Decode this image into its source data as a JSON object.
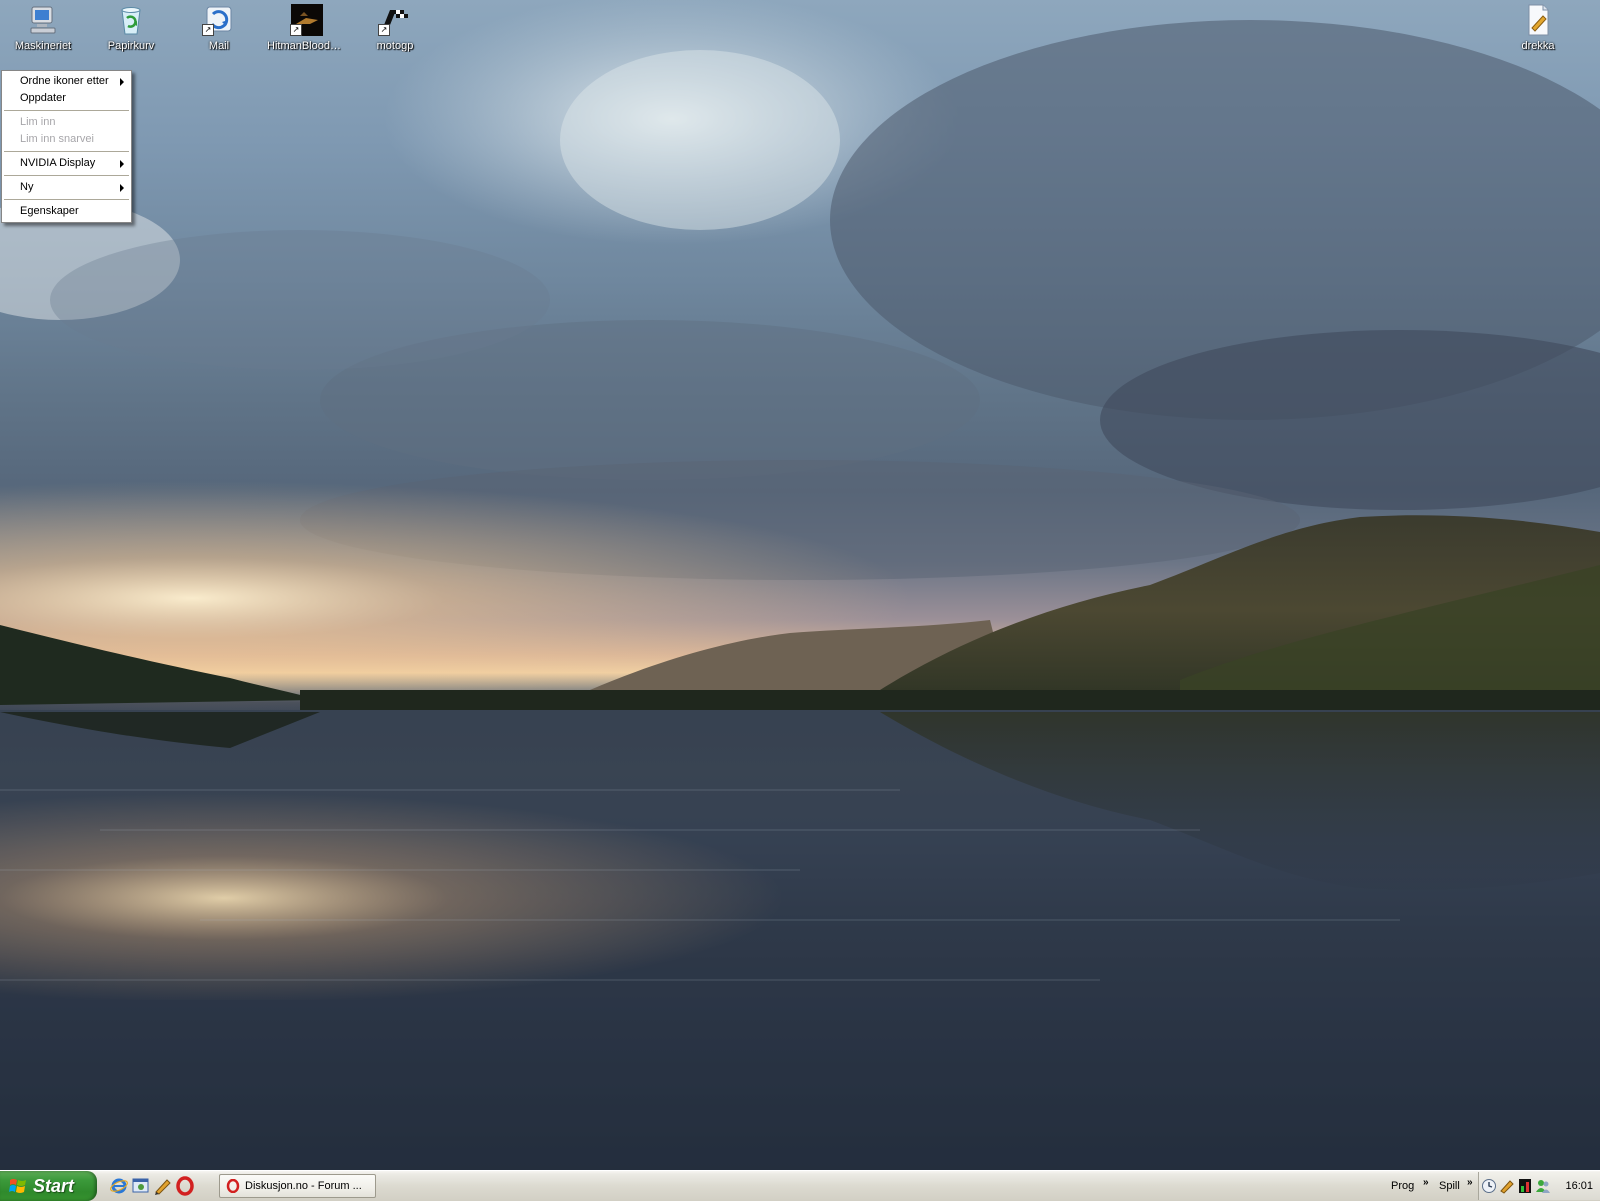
{
  "desktop": {
    "icons": [
      {
        "label": "Maskineriet",
        "icon": "my-computer-icon"
      },
      {
        "label": "Papirkurv",
        "icon": "recycle-bin-icon"
      },
      {
        "label": "Mail",
        "icon": "mail-shortcut-icon"
      },
      {
        "label": "HitmanBloodM...",
        "icon": "hitman-game-icon"
      },
      {
        "label": "motogp",
        "icon": "motogp-game-icon"
      },
      {
        "label": "drekka",
        "icon": "text-document-icon"
      }
    ]
  },
  "context_menu": {
    "items": [
      {
        "label": "Ordne ikoner etter",
        "submenu": true,
        "enabled": true
      },
      {
        "label": "Oppdater",
        "submenu": false,
        "enabled": true
      },
      {
        "label": "Lim inn",
        "submenu": false,
        "enabled": false
      },
      {
        "label": "Lim inn snarvei",
        "submenu": false,
        "enabled": false
      },
      {
        "label": "NVIDIA Display",
        "submenu": true,
        "enabled": true
      },
      {
        "label": "Ny",
        "submenu": true,
        "enabled": true
      },
      {
        "label": "Egenskaper",
        "submenu": false,
        "enabled": true
      }
    ]
  },
  "taskbar": {
    "start_label": "Start",
    "quick_launch": [
      "internet-explorer-icon",
      "show-desktop-icon",
      "pencil-icon",
      "opera-icon"
    ],
    "task_button_label": "Diskusjon.no - Forum ...",
    "toolbars": [
      "Prog",
      "Spill"
    ],
    "clock": "16:01"
  },
  "colors": {
    "start_green": "#3c9a3b",
    "menu_disabled": "#a7a6aa",
    "taskbar_bg": "#dcdad0"
  }
}
